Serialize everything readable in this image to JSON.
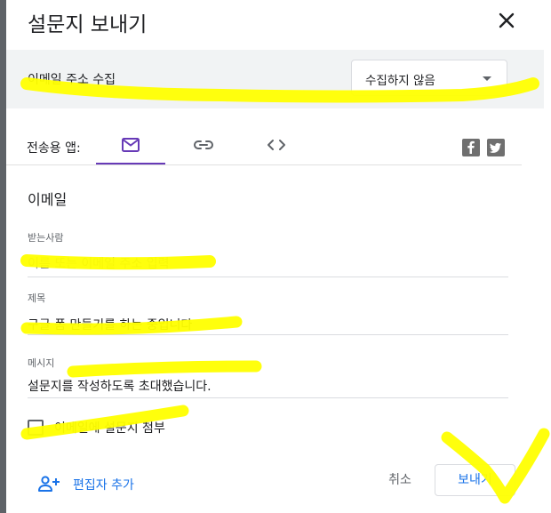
{
  "dialog": {
    "title": "설문지 보내기",
    "close_icon": "close-icon"
  },
  "collect": {
    "label": "이메일 주소 수집",
    "selected": "수집하지 않음"
  },
  "send_via": {
    "label": "전송용 앱:",
    "tabs": [
      {
        "icon": "email-icon",
        "active": true
      },
      {
        "icon": "link-icon",
        "active": false
      },
      {
        "icon": "embed-code-icon",
        "active": false
      }
    ],
    "social": [
      "facebook-icon",
      "twitter-icon"
    ]
  },
  "email": {
    "section_title": "이메일",
    "to_label": "받는사람",
    "to_placeholder": "이름 또는 이메일 주소 입력",
    "subject_label": "제목",
    "subject_value": "구글 폼 만들기를 하는 중입니다",
    "message_label": "메시지",
    "message_value": "설문지를 작성하도록 초대했습니다.",
    "attach_label": "이메일에 설문지 첨부"
  },
  "footer": {
    "add_editor_label": "편집자 추가",
    "cancel_label": "취소",
    "send_label": "보내기"
  },
  "colors": {
    "accent": "#673ab7",
    "link": "#1a73e8",
    "highlighter": "#ffff00"
  }
}
